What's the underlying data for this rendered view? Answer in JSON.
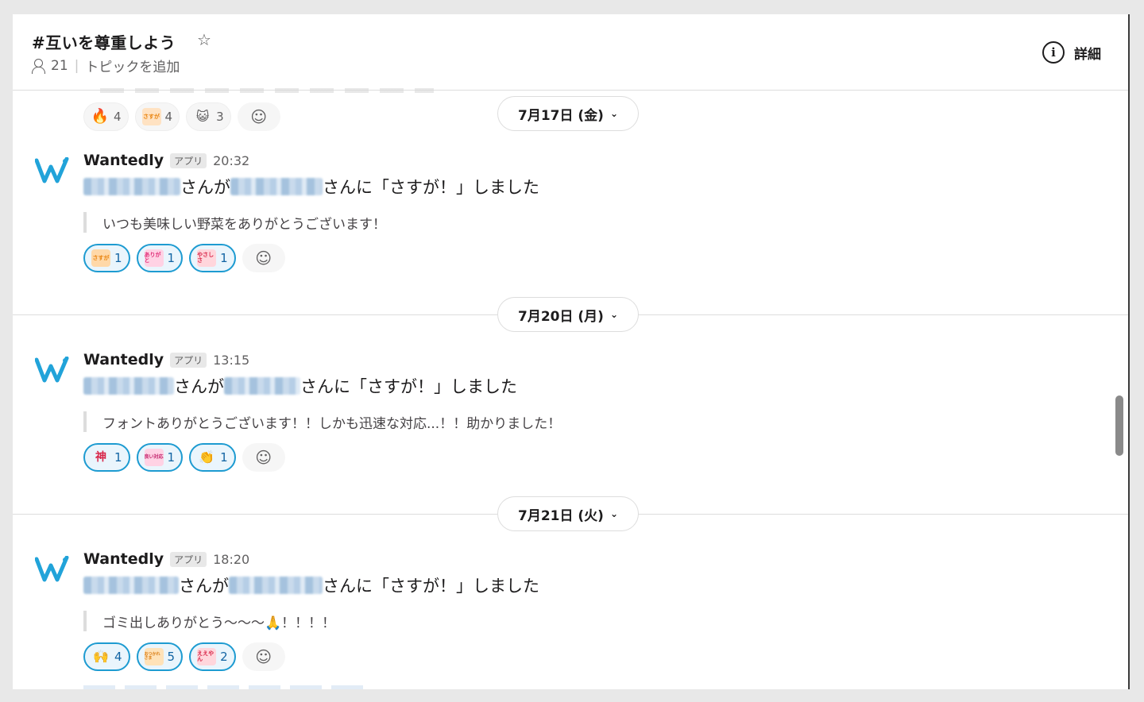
{
  "header": {
    "channel_name": "#互いを尊重しよう",
    "member_count": "21",
    "add_topic": "トピックを追加",
    "details_label": "詳細"
  },
  "top_reactions": [
    {
      "emoji": "🔥",
      "count": "4"
    },
    {
      "emoji": "さすが",
      "count": "4"
    },
    {
      "emoji": "😺",
      "count": "3"
    }
  ],
  "date_dividers": [
    {
      "label": "7月17日 (金)"
    },
    {
      "label": "7月20日 (月)"
    },
    {
      "label": "7月21日 (火)"
    }
  ],
  "messages": [
    {
      "sender": "Wantedly",
      "badge": "アプリ",
      "time": "20:32",
      "text_mid": "さんが",
      "text_end": "さんに「さすが！」しました",
      "quote": "いつも美味しい野菜をありがとうございます！",
      "reactions": [
        {
          "emoji": "さすが",
          "count": "1"
        },
        {
          "emoji": "ありがと",
          "count": "1"
        },
        {
          "emoji": "やさしさ",
          "count": "1"
        }
      ]
    },
    {
      "sender": "Wantedly",
      "badge": "アプリ",
      "time": "13:15",
      "text_mid": "さんが",
      "text_end": "さんに「さすが！」しました",
      "quote": "フォントありがとうございます！！しかも迅速な対応...！！助かりました！",
      "reactions": [
        {
          "emoji": "神",
          "count": "1"
        },
        {
          "emoji": "良い対応",
          "count": "1"
        },
        {
          "emoji": "👏",
          "count": "1"
        }
      ]
    },
    {
      "sender": "Wantedly",
      "badge": "アプリ",
      "time": "18:20",
      "text_mid": "さんが",
      "text_end": "さんに「さすが！」しました",
      "quote": "ゴミ出しありがとう〜〜〜🙏！！！！",
      "reactions": [
        {
          "emoji": "🙌",
          "count": "4"
        },
        {
          "emoji": "おつかれさま",
          "count": "5"
        },
        {
          "emoji": "ええやん",
          "count": "2"
        }
      ]
    }
  ],
  "colors": {
    "accent": "#1d9bd1",
    "brand": "#21a3d9"
  }
}
